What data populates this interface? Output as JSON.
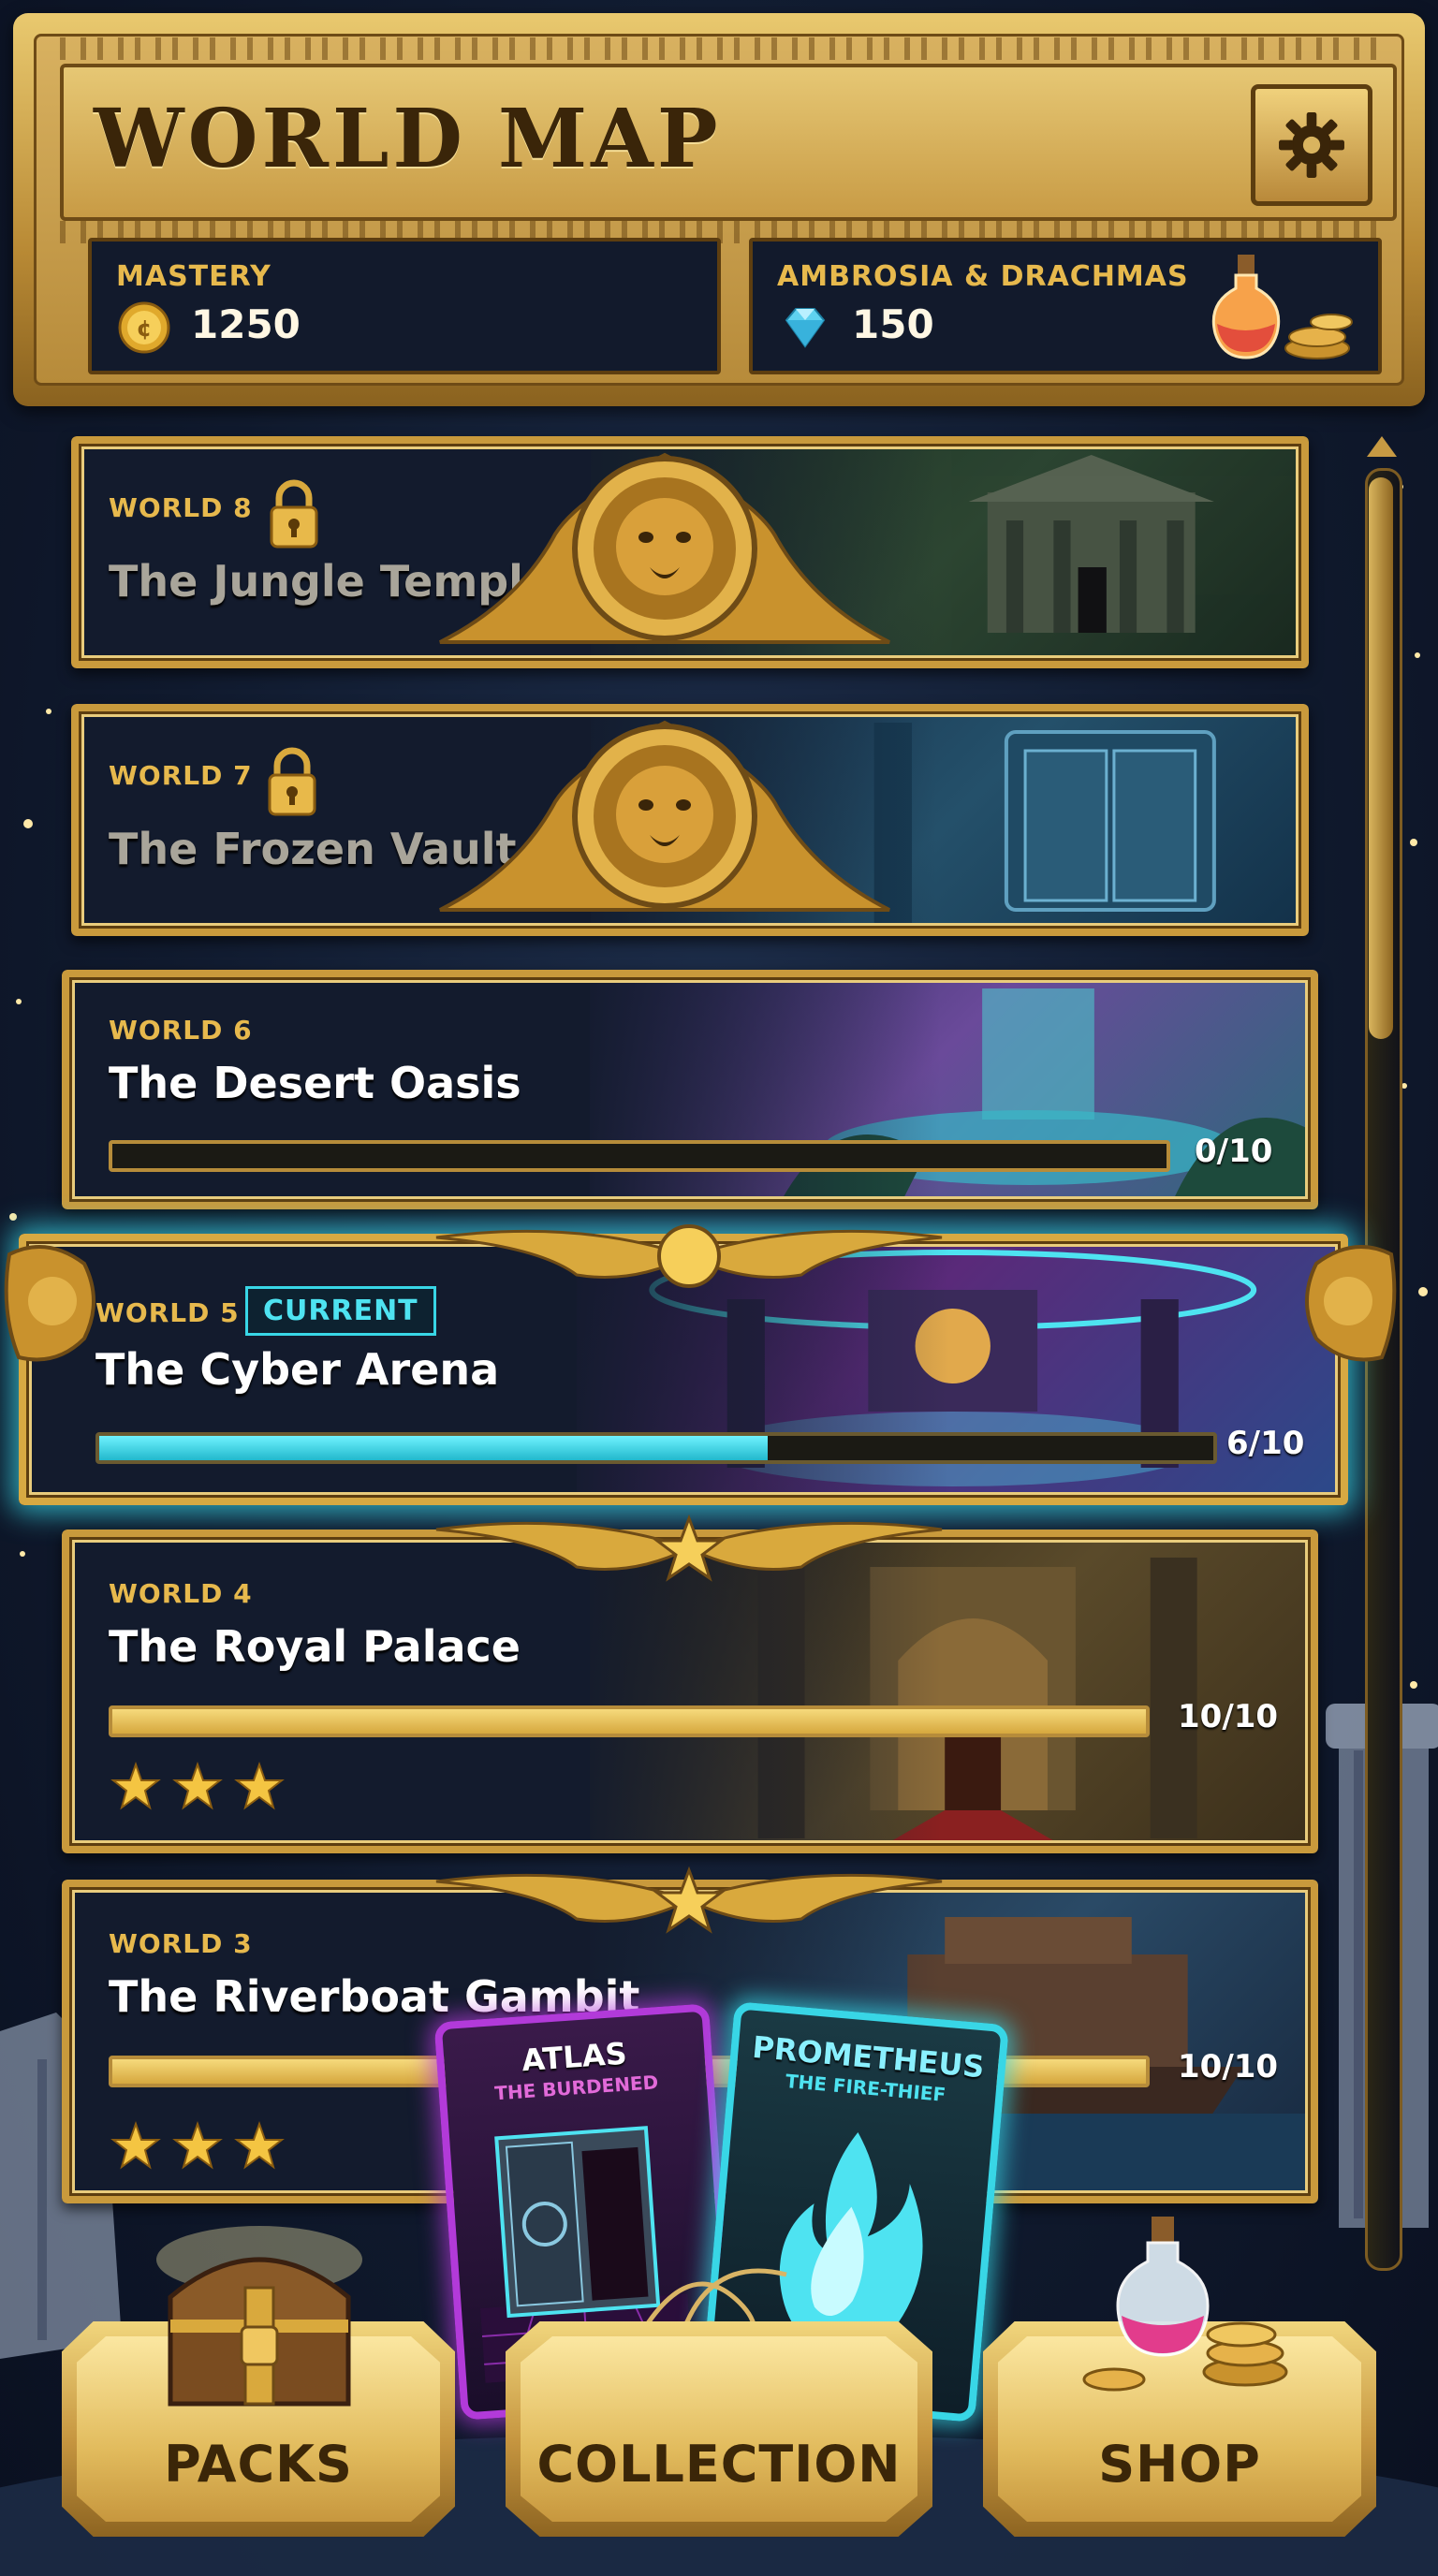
{
  "header": {
    "title": "WORLD MAP",
    "mastery": {
      "label": "MASTERY",
      "value": "1250",
      "icon": "gold-coin-icon"
    },
    "currency": {
      "label": "AMBROSIA & DRACHMAS",
      "value": "150",
      "icon": "diamond-icon"
    },
    "settings_icon": "gear-icon"
  },
  "worlds": [
    {
      "label": "WORLD 8",
      "name": "The Jungle Temple",
      "locked": true
    },
    {
      "label": "WORLD 7",
      "name": "The Frozen Vault",
      "locked": true
    },
    {
      "label": "WORLD 6",
      "name": "The Desert Oasis",
      "progress_text": "0/10",
      "progress": 0
    },
    {
      "label": "WORLD 5",
      "name": "The Cyber Arena",
      "badge": "CURRENT",
      "progress_text": "6/10",
      "progress": 0.6
    },
    {
      "label": "WORLD 4",
      "name": "The Royal Palace",
      "progress_text": "10/10",
      "progress": 1.0,
      "stars": 3
    },
    {
      "label": "WORLD 3",
      "name": "The Riverboat Gambit",
      "progress_text": "10/10",
      "progress": 1.0,
      "stars": 3
    }
  ],
  "cards": [
    {
      "title": "ATLAS",
      "subtitle": "THE BURDENED"
    },
    {
      "title": "PROMETHEUS",
      "subtitle": "THE FIRE-THIEF"
    }
  ],
  "nav": {
    "packs": "PACKS",
    "collection": "COLLECTION",
    "shop": "SHOP"
  },
  "colors": {
    "gold": "#c99a3c",
    "accent_cyan": "#38d6e6",
    "progress_gold": "#e8c45a",
    "bg": "#101a2e"
  }
}
